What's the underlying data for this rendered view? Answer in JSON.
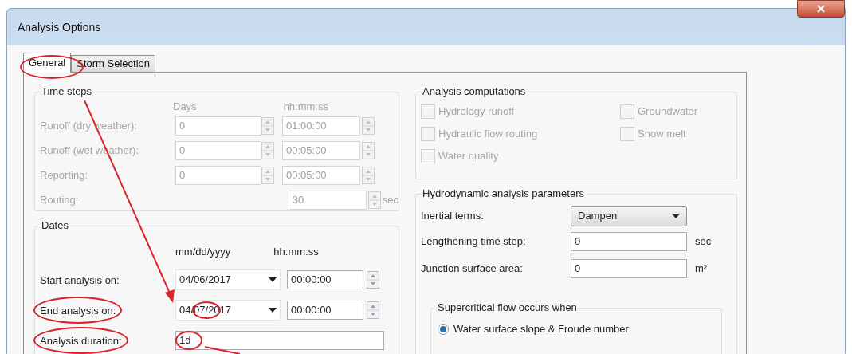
{
  "window": {
    "title": "Analysis Options"
  },
  "tabs": [
    {
      "label": "General",
      "selected": true
    },
    {
      "label": "Storm Selection",
      "selected": false
    }
  ],
  "time_steps": {
    "title": "Time steps",
    "column_headers": [
      "Days",
      "hh:mm:ss"
    ],
    "rows": [
      {
        "label": "Runoff (dry weather):",
        "days": "0",
        "time": "01:00:00",
        "disabled": true
      },
      {
        "label": "Runoff (wet weather):",
        "days": "0",
        "time": "00:05:00",
        "disabled": true
      },
      {
        "label": "Reporting:",
        "days": "0",
        "time": "00:05:00",
        "disabled": true
      }
    ],
    "routing": {
      "label": "Routing:",
      "value": "30",
      "unit": "sec",
      "disabled": true
    }
  },
  "dates": {
    "title": "Dates",
    "column_headers": [
      "mm/dd/yyyy",
      "hh:mm:ss"
    ],
    "rows": [
      {
        "label": "Start analysis on:",
        "date": "04/06/2017",
        "time": "00:00:00"
      },
      {
        "label": "End analysis on:",
        "date": "04/07/2017",
        "time": "00:00:00"
      }
    ],
    "duration": {
      "label": "Analysis duration:",
      "value": "1d"
    }
  },
  "analysis_computations": {
    "title": "Analysis computations",
    "options": [
      {
        "label": "Hydrology runoff",
        "checked": false,
        "disabled": true
      },
      {
        "label": "Groundwater",
        "checked": false,
        "disabled": true
      },
      {
        "label": "Hydraulic flow routing",
        "checked": false,
        "disabled": true
      },
      {
        "label": "Snow melt",
        "checked": false,
        "disabled": true
      },
      {
        "label": "Water quality",
        "checked": false,
        "disabled": true
      }
    ]
  },
  "hydrodynamic": {
    "title": "Hydrodynamic analysis parameters",
    "inertial_terms": {
      "label": "Inertial terms:",
      "value": "Dampen"
    },
    "lengthening": {
      "label": "Lengthening time step:",
      "value": "0",
      "unit": "sec"
    },
    "junction": {
      "label": "Junction surface area:",
      "value": "0",
      "unit": "m²"
    },
    "supercritical": {
      "title": "Supercritical flow occurs when",
      "options": [
        {
          "label": "Water surface slope & Froude number",
          "selected": true
        }
      ]
    }
  }
}
